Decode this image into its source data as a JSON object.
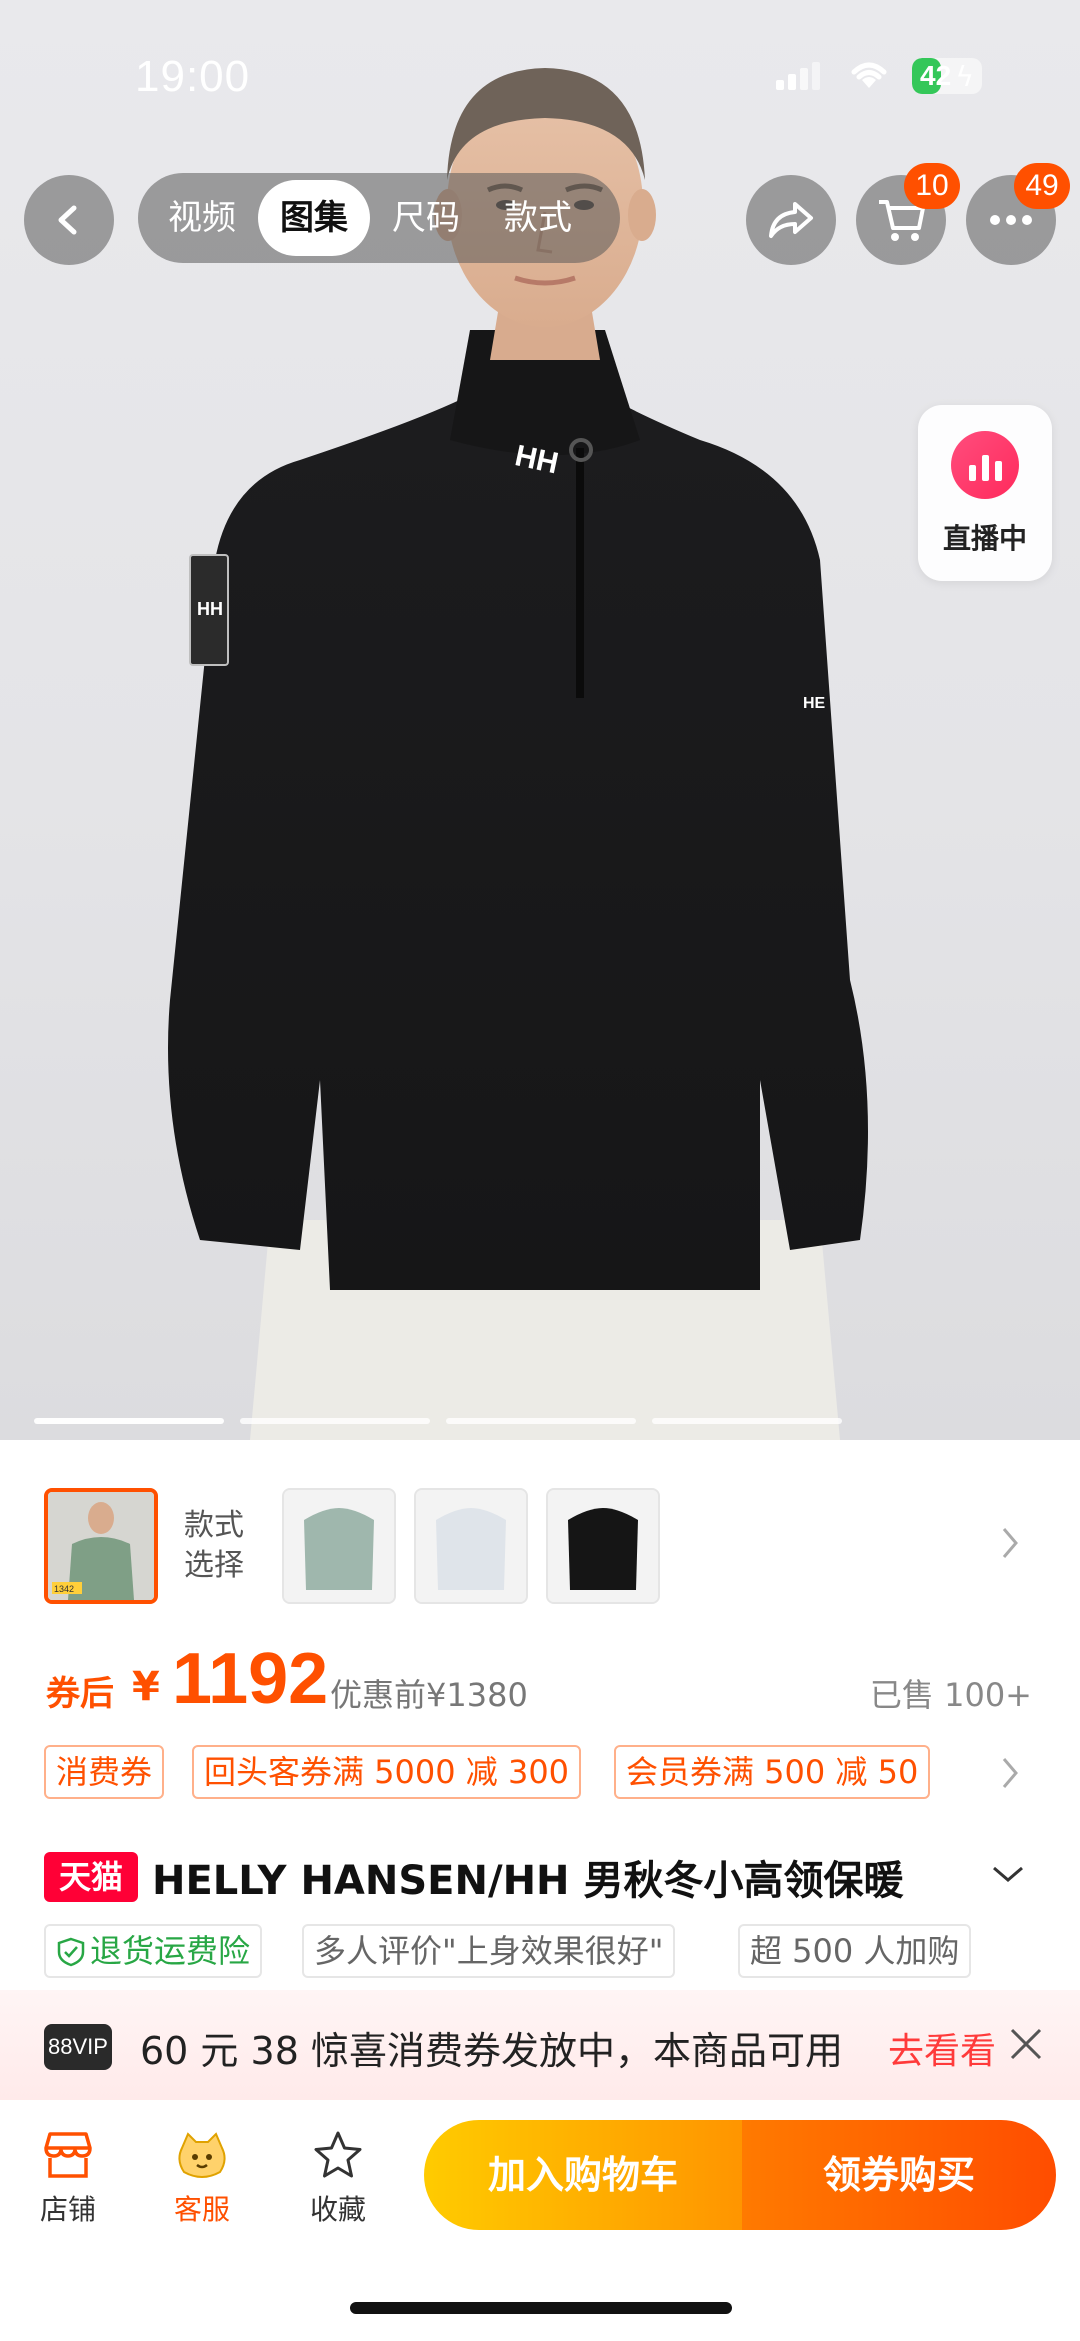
{
  "status_bar": {
    "time": "19:00",
    "battery": "42",
    "battery_level": 0.42
  },
  "top_nav": {
    "tabs": [
      {
        "label": "视频",
        "active": false
      },
      {
        "label": "图集",
        "active": true
      },
      {
        "label": "尺码",
        "active": false
      },
      {
        "label": "款式",
        "active": false
      }
    ],
    "cart_badge": "10",
    "more_badge": "49",
    "icons": [
      "back-icon",
      "share-icon",
      "cart-icon",
      "more-icon"
    ]
  },
  "live": {
    "label": "直播中"
  },
  "gallery": {
    "pages": 4,
    "current_page": 1
  },
  "style_selector": {
    "label": "款式选择",
    "swatch_colors": [
      "#9fb7ad",
      "#dfe4ea",
      "#151515"
    ],
    "selected_thumb_text": "1342"
  },
  "price": {
    "prefix": "券后",
    "currency": "¥",
    "value": "1192",
    "before": "优惠前¥1380",
    "sold": "已售 100+"
  },
  "coupons": [
    "消费券",
    "回头客券满 5000 减 300",
    "会员券满 500 减 50"
  ],
  "title": {
    "badge": "天猫",
    "text": "HELLY HANSEN/HH 男秋冬小高领保暖"
  },
  "tags": [
    "退货运费险",
    "多人评价\"上身效果很好\"",
    "超 500 人加购"
  ],
  "vip_bar": {
    "badge": "88VIP",
    "text": "60 元 38 惊喜消费券发放中，本商品可用",
    "link": "去看看"
  },
  "bottom_bar": {
    "store": "店铺",
    "service": "客服",
    "favorite": "收藏",
    "add_to_cart": "加入购物车",
    "buy": "领券购买"
  },
  "colors": {
    "accent": "#ff5000",
    "tmall_red": "#ff0036",
    "cart_button": "#ffb300",
    "buy_button": "#ff5a00"
  }
}
